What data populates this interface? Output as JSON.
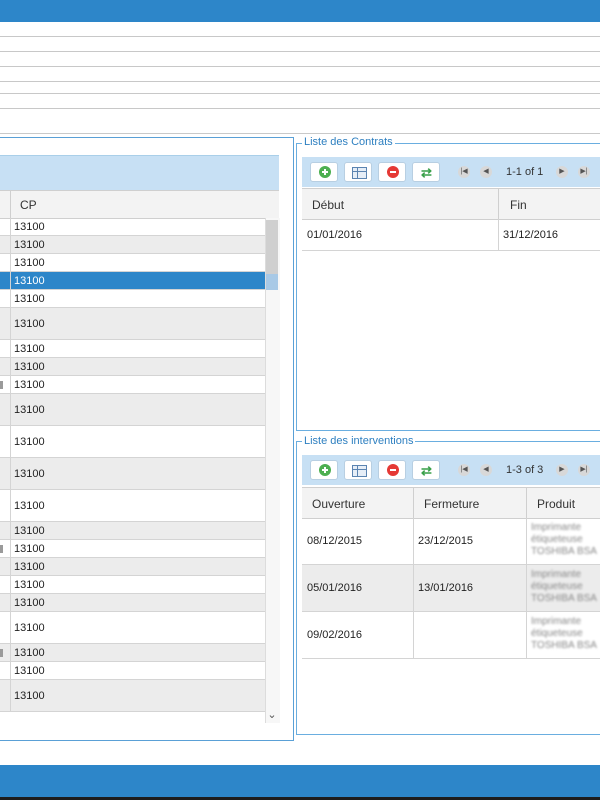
{
  "left_grid": {
    "column_header": "CP",
    "rows": [
      {
        "cp": "13100",
        "style": "normal"
      },
      {
        "cp": "13100",
        "style": "alt"
      },
      {
        "cp": "13100",
        "style": "normal"
      },
      {
        "cp": "13100",
        "style": "selected"
      },
      {
        "cp": "13100",
        "style": "normal"
      },
      {
        "cp": "13100",
        "style": "alt"
      },
      {
        "cp": "13100",
        "style": "normal"
      },
      {
        "cp": "13100",
        "style": "alt"
      },
      {
        "cp": "13100",
        "style": "normal"
      },
      {
        "cp": "13100",
        "style": "alt"
      },
      {
        "cp": "13100",
        "style": "normal"
      },
      {
        "cp": "13100",
        "style": "alt"
      },
      {
        "cp": "13100",
        "style": "normal"
      },
      {
        "cp": "13100",
        "style": "alt"
      },
      {
        "cp": "13100",
        "style": "normal"
      },
      {
        "cp": "13100",
        "style": "alt"
      },
      {
        "cp": "13100",
        "style": "normal"
      },
      {
        "cp": "13100",
        "style": "alt"
      },
      {
        "cp": "13100",
        "style": "normal"
      },
      {
        "cp": "13100",
        "style": "alt"
      },
      {
        "cp": "13100",
        "style": "normal"
      },
      {
        "cp": "13100",
        "style": "alt"
      }
    ]
  },
  "contrats": {
    "legend": "Liste des Contrats",
    "page_info": "1-1 of 1",
    "columns": [
      "Début",
      "Fin"
    ],
    "rows": [
      {
        "debut": "01/01/2016",
        "fin": "31/12/2016"
      }
    ]
  },
  "interventions": {
    "legend": "Liste des interventions",
    "page_info": "1-3 of 3",
    "columns": [
      "Ouverture",
      "Fermeture",
      "Produit"
    ],
    "rows": [
      {
        "ouverture": "08/12/2015",
        "fermeture": "23/12/2015",
        "produit": [
          "Imprimante",
          "étiqueteuse",
          "TOSHIBA BSA"
        ]
      },
      {
        "ouverture": "05/01/2016",
        "fermeture": "13/01/2016",
        "produit": [
          "Imprimante",
          "étiqueteuse",
          "TOSHIBA BSA"
        ]
      },
      {
        "ouverture": "09/02/2016",
        "fermeture": "",
        "produit": [
          "Imprimante",
          "étiqueteuse",
          "TOSHIBA BSA"
        ]
      }
    ]
  },
  "icons": {
    "add": "add-icon",
    "columns": "columns-icon",
    "delete": "delete-icon",
    "refresh": "refresh-icon",
    "first": "first-page-icon",
    "prev": "prev-page-icon",
    "next": "next-page-icon",
    "last": "last-page-icon"
  },
  "colors": {
    "accent": "#2d86c9",
    "header": "#c7e0f4",
    "row_alt": "#ececec"
  }
}
